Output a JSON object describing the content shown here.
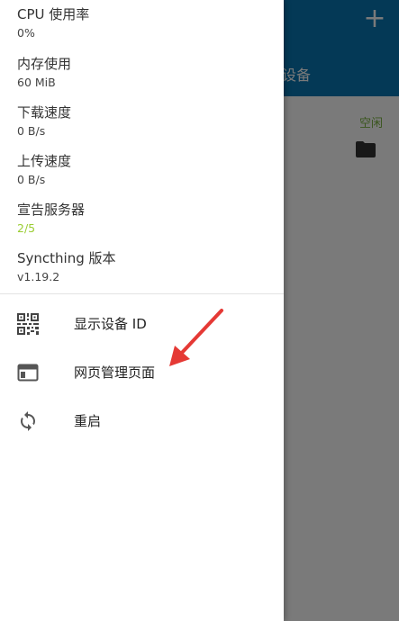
{
  "background": {
    "tab_label": "设备",
    "status_text": "空闲",
    "add_icon": "plus-icon",
    "folder_icon": "folder-icon"
  },
  "drawer": {
    "stats": [
      {
        "label": "CPU 使用率",
        "value": "0%"
      },
      {
        "label": "内存使用",
        "value": "60 MiB"
      },
      {
        "label": "下载速度",
        "value": "0 B/s"
      },
      {
        "label": "上传速度",
        "value": "0 B/s"
      },
      {
        "label": "宣告服务器",
        "value": "2/5"
      },
      {
        "label": "Syncthing 版本",
        "value": "v1.19.2"
      }
    ],
    "menu": [
      {
        "label": "显示设备 ID",
        "icon": "qr-code-icon"
      },
      {
        "label": "网页管理页面",
        "icon": "web-window-icon"
      },
      {
        "label": "重启",
        "icon": "sync-icon"
      }
    ]
  },
  "colors": {
    "toolbar": "#0a78b5",
    "green_value": "#9acd32",
    "annotation_arrow": "#e53935"
  }
}
